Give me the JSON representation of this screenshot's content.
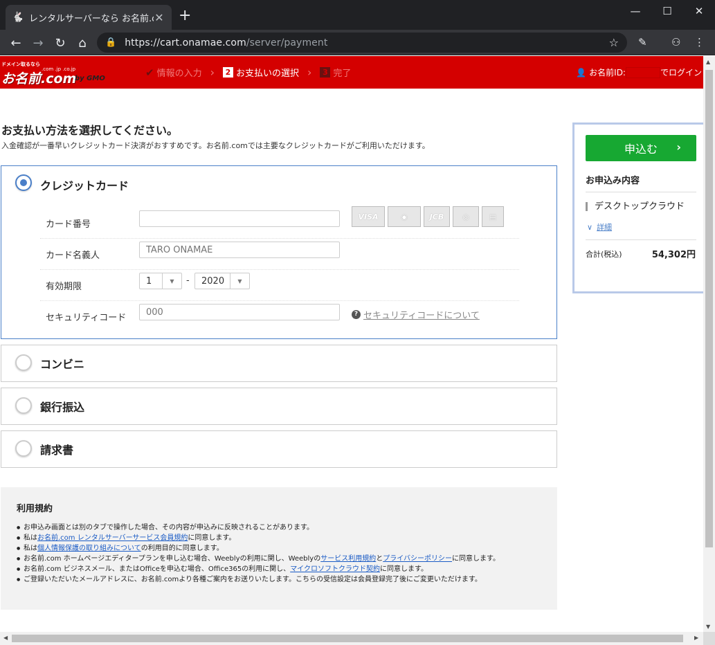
{
  "browser": {
    "tab_title": "レンタルサーバーなら お名前.com",
    "tab_close": "✕",
    "new_tab": "+",
    "url_host": "https://cart.onamae.com",
    "url_path": "/server/payment",
    "win_min": "—",
    "win_max": "☐",
    "win_close": "✕"
  },
  "header": {
    "logo_tagline": "ドメイン取るなら",
    "logo_tlds": ".com .jp .co.jp",
    "logo_name": "お名前.com",
    "logo_gmo": "by GMO",
    "steps": [
      {
        "label": "情報の入力",
        "state": "done"
      },
      {
        "num": "2",
        "label": "お支払いの選択",
        "state": "current"
      },
      {
        "num": "3",
        "label": "完了",
        "state": "next"
      }
    ],
    "login_prefix": "お名前ID:",
    "login_suffix": "でログイン"
  },
  "main": {
    "title": "お支払い方法を選択してください。",
    "lead": "入金確認が一番早いクレジットカード決済がおすすめです。お名前.comでは主要なクレジットカードがご利用いただけます。",
    "payment_methods": [
      {
        "label": "クレジットカード",
        "selected": true
      },
      {
        "label": "コンビニ",
        "selected": false
      },
      {
        "label": "銀行振込",
        "selected": false
      },
      {
        "label": "請求書",
        "selected": false
      }
    ],
    "form": {
      "card_number_label": "カード番号",
      "card_number_value": "",
      "holder_label": "カード名義人",
      "holder_placeholder": "TARO ONAMAE",
      "expiry_label": "有効期限",
      "expiry_month": "1",
      "expiry_sep": "-",
      "expiry_year": "2020",
      "cvc_label": "セキュリティコード",
      "cvc_placeholder": "000",
      "cvc_help": "セキュリティコードについて"
    },
    "card_brands": [
      "VISA",
      "",
      "JCB",
      "",
      ""
    ]
  },
  "terms": {
    "heading": "利用規約",
    "items": [
      {
        "pre": "お申込み画面とは別のタブで操作した場合、その内容が申込みに反映されることがあります。"
      },
      {
        "pre": "私は",
        "link": "お名前.com レンタルサーバーサービス会員規約",
        "post": "に同意します。"
      },
      {
        "pre": "私は",
        "link": "個人情報保護の取り組みについて",
        "post": "の利用目的に同意します。"
      },
      {
        "pre": "お名前.com ホームページエディタープランを申し込む場合、Weeblyの利用に関し、Weeblyの",
        "link": "サービス利用規約",
        "mid": "と",
        "link2": "プライバシーポリシー",
        "post": "に同意します。"
      },
      {
        "pre": "お名前.com ビジネスメール、またはOfficeを申込む場合、Office365の利用に関し、",
        "link": "マイクロソフトクラウド契約",
        "post": "に同意します。"
      },
      {
        "pre": "ご登録いただいたメールアドレスに、お名前.comより各種ご案内をお送りいたします。こちらの受信設定は会員登録完了後にご変更いただけます。"
      }
    ]
  },
  "side": {
    "apply_label": "申込む",
    "summary_heading": "お申込み内容",
    "item": "デスクトップクラウド",
    "detail_label": "詳細",
    "total_label": "合計(税込)",
    "total_value": "54,302円"
  },
  "colors": {
    "header_red": "#d40000",
    "accent_blue": "#4a7fc8",
    "apply_green": "#17a832"
  }
}
